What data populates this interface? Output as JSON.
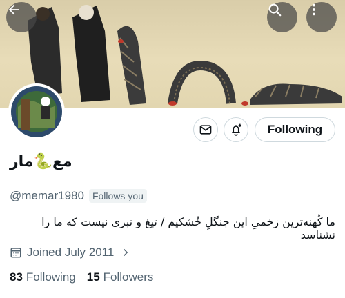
{
  "header": {
    "back_icon": "arrow-left-icon",
    "search_icon": "search-icon",
    "more_icon": "more-vertical-icon",
    "banner_colors": [
      "#e2d6b0",
      "#2a2a2a",
      "#c0392b"
    ]
  },
  "actions": {
    "message_icon": "envelope-icon",
    "notify_icon": "bell-plus-icon",
    "following_label": "Following"
  },
  "profile": {
    "display_name_prefix": "مع",
    "display_name_emoji": "🐍",
    "display_name_suffix": "مار",
    "handle": "@memar1980",
    "follows_you": "Follows you",
    "bio": "ما کُهنه‌ترین زخمیِ این جنگلِ خُشکیم / تیغ و تبری نیست که ما را نشناسد",
    "joined": "Joined July 2011"
  },
  "stats": {
    "following_count": "83",
    "following_label": "Following",
    "followers_count": "15",
    "followers_label": "Followers"
  }
}
